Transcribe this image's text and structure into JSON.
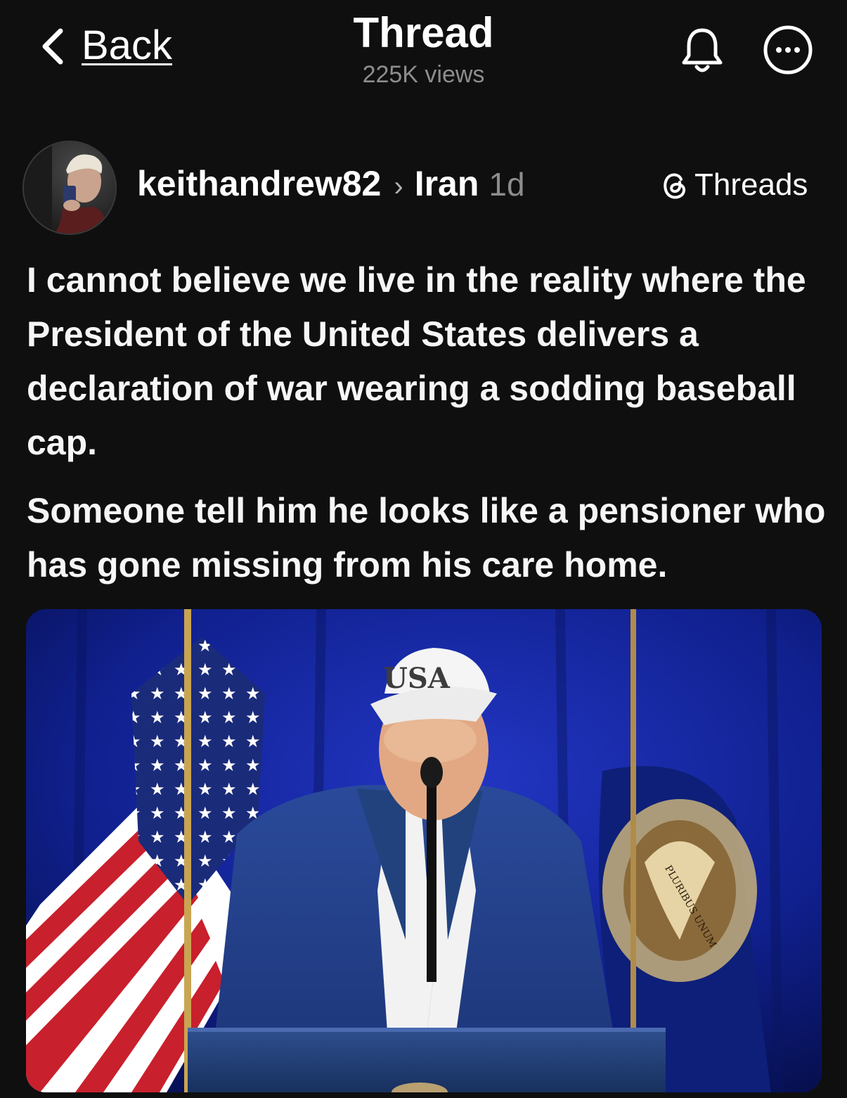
{
  "header": {
    "back_label": "Back",
    "title": "Thread",
    "views": "225K views",
    "bell_icon": "bell-icon",
    "more_icon": "more-options-icon"
  },
  "post": {
    "username": "keithandrew82",
    "separator": "›",
    "topic": "Iran",
    "time": "1d",
    "source_label": "Threads",
    "source_icon": "threads-logo-icon",
    "paragraphs": [
      "I cannot believe we live in the reality where the President of the United States delivers a declaration of war wearing a sodding baseball cap.",
      "Someone tell him he looks like a pensioner who has gone missing from his care home."
    ],
    "image": {
      "cap_text": "USA",
      "seal_text": "PLURIBUS UNUM"
    }
  },
  "colors": {
    "background": "#0f0f0f",
    "text": "#f6f6f6",
    "muted": "#8d8d8d",
    "photo_backdrop": "#0a1a6a"
  }
}
